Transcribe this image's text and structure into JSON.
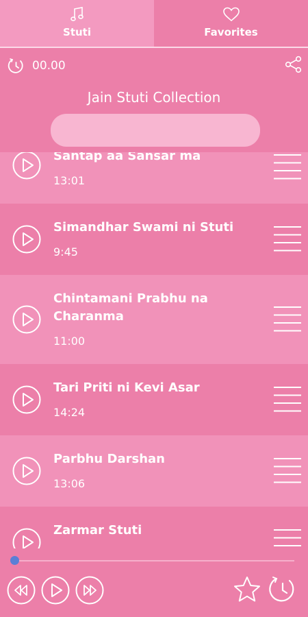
{
  "tabs": [
    {
      "label": "Stuti",
      "icon": "music-note-icon",
      "active": true
    },
    {
      "label": "Favorites",
      "icon": "heart-icon",
      "active": false
    }
  ],
  "header": {
    "timer": "00.00",
    "collection_title": "Jain Stuti Collection",
    "search": {
      "value": "",
      "placeholder": ""
    }
  },
  "songs": [
    {
      "title": "Santap aa Sansar ma",
      "duration": "13:01"
    },
    {
      "title": "Simandhar Swami ni Stuti",
      "duration": "9:45"
    },
    {
      "title": "Chintamani Prabhu na Charanma",
      "duration": "11:00"
    },
    {
      "title": "Tari Priti ni Kevi Asar",
      "duration": "14:24"
    },
    {
      "title": "Parbhu Darshan",
      "duration": "13:06"
    },
    {
      "title": "Zarmar Stuti",
      "duration": ""
    }
  ],
  "player": {
    "progress": 0.0
  },
  "colors": {
    "background": "#ec7fa9",
    "active_tab": "#f192b9",
    "light_row": "#f192b9",
    "search": "#f8b6d1",
    "seek_thumb": "#5b7fd6"
  }
}
